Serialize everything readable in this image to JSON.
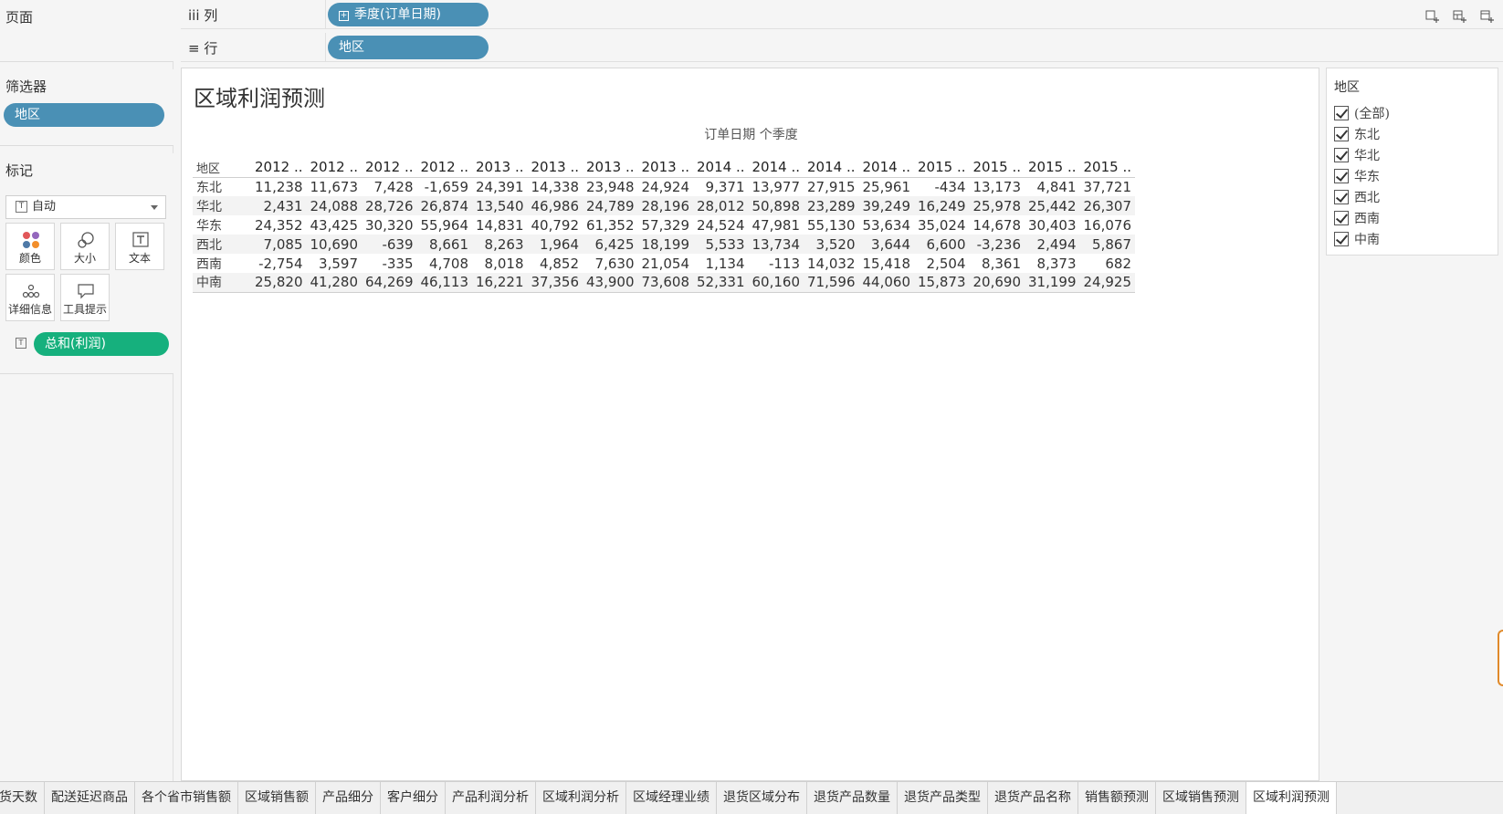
{
  "pages_card": {
    "title": "页面"
  },
  "filters_card": {
    "title": "筛选器",
    "pill": "地区"
  },
  "marks_card": {
    "title": "标记",
    "type_select": "自动",
    "buttons": [
      {
        "label": "颜色",
        "icon": "color-dots-icon"
      },
      {
        "label": "大小",
        "icon": "size-circles-icon"
      },
      {
        "label": "文本",
        "icon": "text-t-icon"
      },
      {
        "label": "详细信息",
        "icon": "detail-dots-icon"
      },
      {
        "label": "工具提示",
        "icon": "tooltip-bubble-icon"
      }
    ],
    "field_pill": "总和(利润)"
  },
  "shelves": {
    "columns": {
      "label": "iii  列",
      "pill": "季度(订单日期)"
    },
    "rows": {
      "label": "≡  行",
      "pill": "地区"
    }
  },
  "worksheet": {
    "title": "区域利润预测",
    "column_caption": "订单日期 个季度",
    "corner_label": "地区",
    "column_headers": [
      "2012 ..",
      "2012 ..",
      "2012 ..",
      "2012 ..",
      "2013 ..",
      "2013 ..",
      "2013 ..",
      "2013 ..",
      "2014 ..",
      "2014 ..",
      "2014 ..",
      "2014 ..",
      "2015 ..",
      "2015 ..",
      "2015 ..",
      "2015 .."
    ],
    "rows": [
      {
        "region": "东北",
        "values": [
          "11,238",
          "11,673",
          "7,428",
          "-1,659",
          "24,391",
          "14,338",
          "23,948",
          "24,924",
          "9,371",
          "13,977",
          "27,915",
          "25,961",
          "-434",
          "13,173",
          "4,841",
          "37,721"
        ]
      },
      {
        "region": "华北",
        "values": [
          "2,431",
          "24,088",
          "28,726",
          "26,874",
          "13,540",
          "46,986",
          "24,789",
          "28,196",
          "28,012",
          "50,898",
          "23,289",
          "39,249",
          "16,249",
          "25,978",
          "25,442",
          "26,307"
        ]
      },
      {
        "region": "华东",
        "values": [
          "24,352",
          "43,425",
          "30,320",
          "55,964",
          "14,831",
          "40,792",
          "61,352",
          "57,329",
          "24,524",
          "47,981",
          "55,130",
          "53,634",
          "35,024",
          "14,678",
          "30,403",
          "16,076"
        ]
      },
      {
        "region": "西北",
        "values": [
          "7,085",
          "10,690",
          "-639",
          "8,661",
          "8,263",
          "1,964",
          "6,425",
          "18,199",
          "5,533",
          "13,734",
          "3,520",
          "3,644",
          "6,600",
          "-3,236",
          "2,494",
          "5,867"
        ]
      },
      {
        "region": "西南",
        "values": [
          "-2,754",
          "3,597",
          "-335",
          "4,708",
          "8,018",
          "4,852",
          "7,630",
          "21,054",
          "1,134",
          "-113",
          "14,032",
          "15,418",
          "2,504",
          "8,361",
          "8,373",
          "682"
        ]
      },
      {
        "region": "中南",
        "values": [
          "25,820",
          "41,280",
          "64,269",
          "46,113",
          "16,221",
          "37,356",
          "43,900",
          "73,608",
          "52,331",
          "60,160",
          "71,596",
          "44,060",
          "15,873",
          "20,690",
          "31,199",
          "24,925"
        ]
      }
    ]
  },
  "legend": {
    "title": "地区",
    "items": [
      "(全部)",
      "东北",
      "华北",
      "华东",
      "西北",
      "西南",
      "中南"
    ]
  },
  "tabs": [
    {
      "label": "货天数",
      "active": false
    },
    {
      "label": "配送延迟商品",
      "active": false
    },
    {
      "label": "各个省市销售额",
      "active": false
    },
    {
      "label": "区域销售额",
      "active": false
    },
    {
      "label": "产品细分",
      "active": false
    },
    {
      "label": "客户细分",
      "active": false
    },
    {
      "label": "产品利润分析",
      "active": false
    },
    {
      "label": "区域利润分析",
      "active": false
    },
    {
      "label": "区域经理业绩",
      "active": false
    },
    {
      "label": "退货区域分布",
      "active": false
    },
    {
      "label": "退货产品数量",
      "active": false
    },
    {
      "label": "退货产品类型",
      "active": false
    },
    {
      "label": "退货产品名称",
      "active": false
    },
    {
      "label": "销售额预测",
      "active": false
    },
    {
      "label": "区域销售预测",
      "active": false
    },
    {
      "label": "区域利润预测",
      "active": true
    }
  ],
  "colors": {
    "pill_blue": "#4a90b5",
    "pill_green": "#16b07d",
    "accent_orange": "#e08a2a"
  }
}
